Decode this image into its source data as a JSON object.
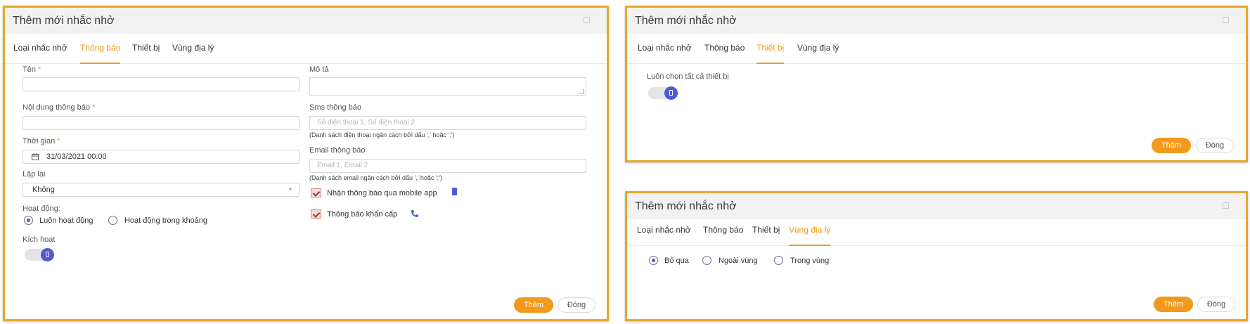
{
  "dialog_title": "Thêm mới nhắc nhở",
  "tabs": [
    "Loại nhắc nhở",
    "Thông báo",
    "Thiết bị",
    "Vùng địa lý"
  ],
  "buttons": {
    "add": "Thêm",
    "close": "Đóng"
  },
  "panel1": {
    "active_tab": "Thông báo",
    "name_label": "Tên",
    "content_label": "Nội dung thông báo",
    "time_label": "Thời gian",
    "time_value": "31/03/2021 00:00",
    "repeat_label": "Lặp lại",
    "repeat_value": "Không",
    "activity_label": "Hoạt động:",
    "activity_options": [
      "Luôn hoạt động",
      "Hoạt động trong khoảng"
    ],
    "activity_selected": "Luôn hoạt động",
    "activate_label": "Kích hoạt",
    "activate_on": true,
    "description_label": "Mô tả",
    "sms_label": "Sms thông báo",
    "sms_placeholder": "Số điện thoại 1, Số điện thoại 2",
    "sms_hint": "(Danh sách điện thoại ngăn cách bởi dấu ',' hoặc ';')",
    "email_label": "Email thông báo",
    "email_placeholder": "Email 1, Email 2",
    "email_hint": "(Danh sách email ngăn cách bởi dấu ',' hoặc ';')",
    "mobile_app_label": "Nhận thông báo qua mobile app",
    "mobile_app_checked": true,
    "emergency_label": "Thông báo khẩn cấp",
    "emergency_checked": true
  },
  "panel2": {
    "active_tab": "Thiết bị",
    "select_all_label": "Luôn chọn tất cả thiết bị",
    "select_all_on": true
  },
  "panel3": {
    "active_tab": "Vùng địa lý",
    "zone_options": [
      "Bỏ qua",
      "Ngoài vùng",
      "Trong vùng"
    ],
    "zone_selected": "Bỏ qua"
  },
  "colors": {
    "accent": "#f29a1d",
    "primary": "#4b5bd6",
    "frame": "#e6a82a"
  },
  "icons": [
    "maximize-icon",
    "calendar-icon",
    "select-arrow-icon",
    "mobile-icon",
    "phone-icon",
    "toggle-knob-icon",
    "textarea-resize-icon"
  ]
}
